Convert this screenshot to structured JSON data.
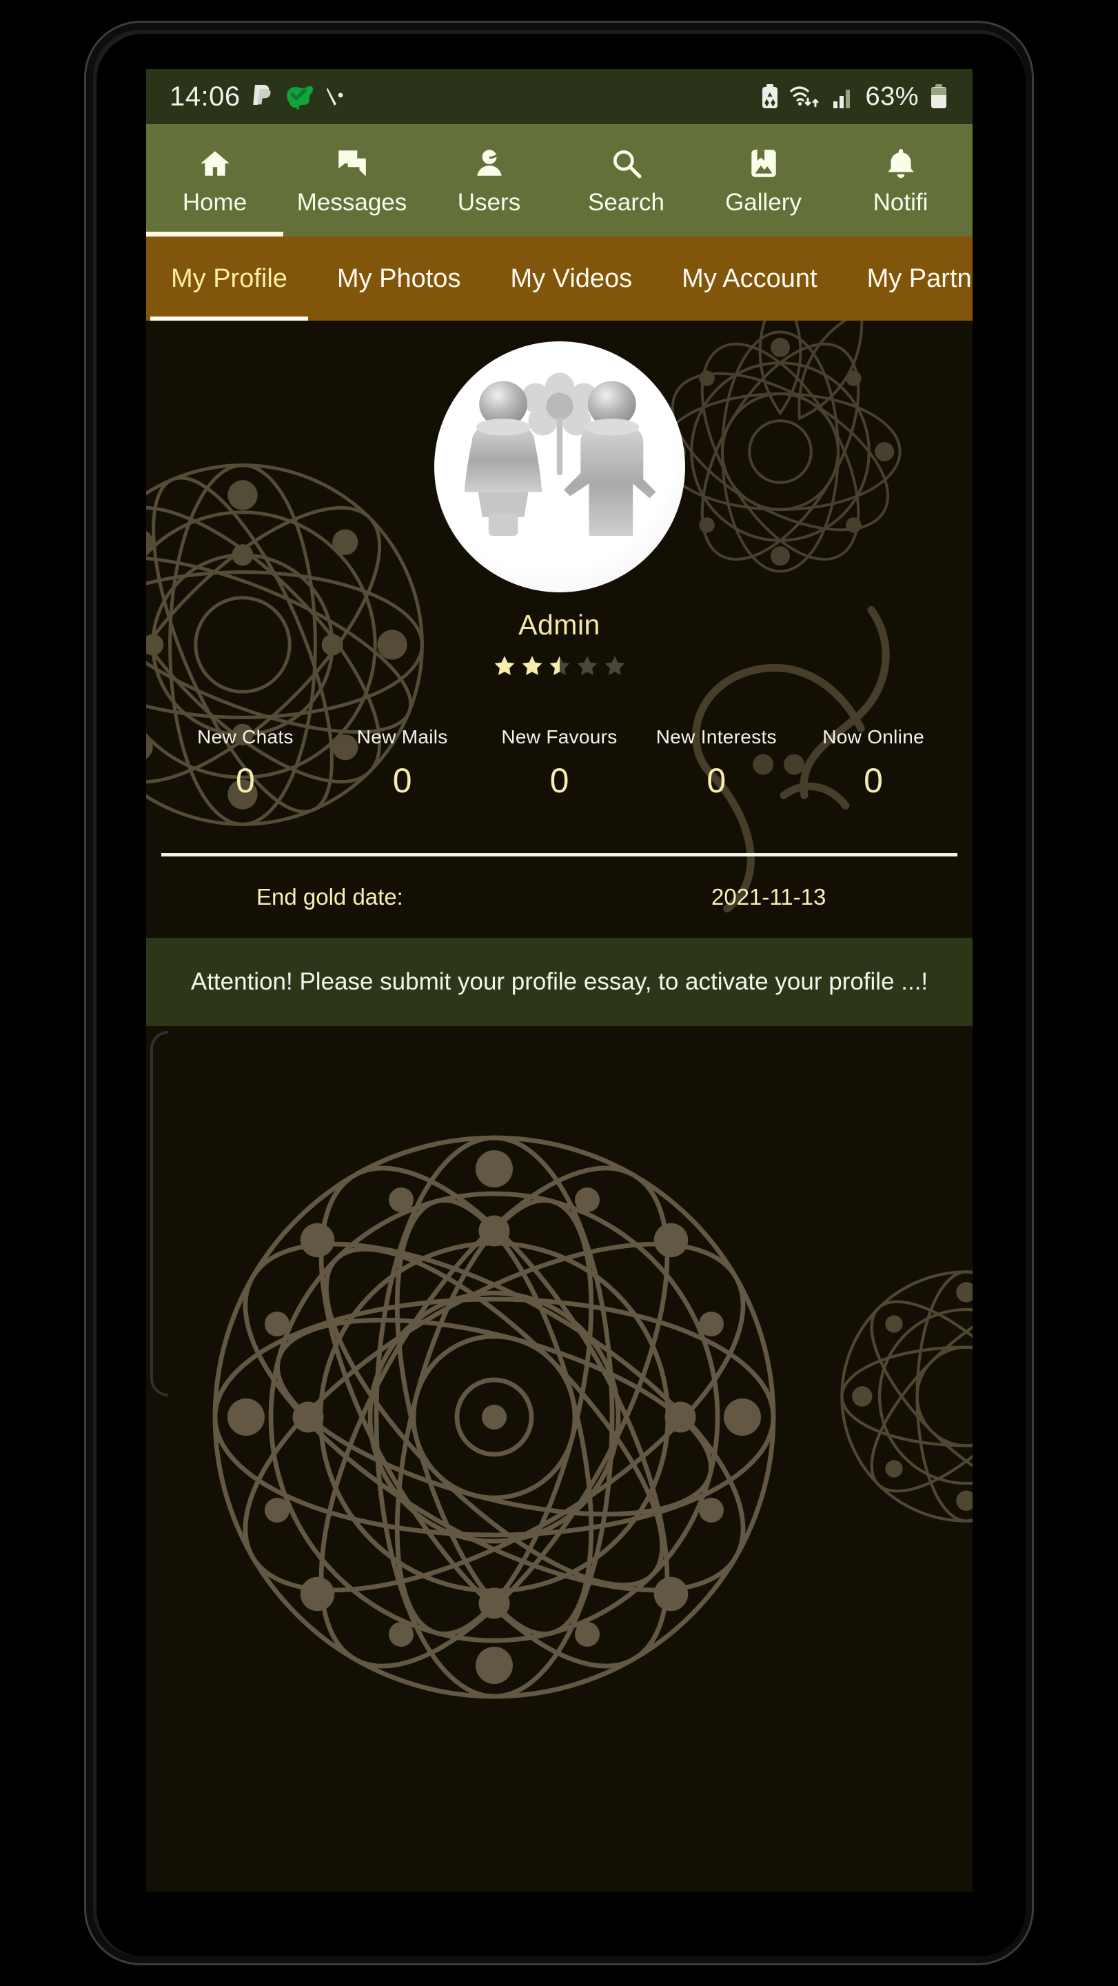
{
  "status_bar": {
    "clock": "14:06",
    "left_icons": [
      "paypal-icon",
      "australia-check-icon",
      "stylus-icon"
    ],
    "right_icons": [
      "battery-saver-icon",
      "wifi-icon",
      "signal-bars-icon"
    ],
    "battery_percent": "63%",
    "background_color": "#2a3418"
  },
  "top_nav": {
    "background_color": "#63703a",
    "items": [
      {
        "label": "Home",
        "icon": "home-icon",
        "active": true
      },
      {
        "label": "Messages",
        "icon": "chat-icon",
        "active": false
      },
      {
        "label": "Users",
        "icon": "person-icon",
        "active": false
      },
      {
        "label": "Search",
        "icon": "search-icon",
        "active": false
      },
      {
        "label": "Gallery",
        "icon": "gallery-icon",
        "active": false
      },
      {
        "label": "Notifi",
        "icon": "bell-icon",
        "active": false
      }
    ]
  },
  "tab_bar": {
    "background_color": "#81560c",
    "active_color": "#fbefa8",
    "items": [
      {
        "label": "My Profile",
        "active": true
      },
      {
        "label": "My Photos",
        "active": false
      },
      {
        "label": "My Videos",
        "active": false
      },
      {
        "label": "My Account",
        "active": false
      },
      {
        "label": "My Partner",
        "active": false
      }
    ]
  },
  "profile": {
    "avatar_icon": "couple-with-flower-avatar",
    "display_name": "Admin",
    "rating_value": 2.5,
    "rating_max": 5,
    "star_filled_color": "#f7edad",
    "star_empty_color": "#4a463c"
  },
  "stats": [
    {
      "label": "New Chats",
      "value": "0"
    },
    {
      "label": "New Mails",
      "value": "0"
    },
    {
      "label": "New Favours",
      "value": "0"
    },
    {
      "label": "New Interests",
      "value": "0"
    },
    {
      "label": "Now Online",
      "value": "0"
    }
  ],
  "gold": {
    "label": "End gold date:",
    "value": "2021-11-13"
  },
  "attention": {
    "message": "Attention! Please submit your profile essay, to activate your profile ...!",
    "background_color": "#2c3618"
  },
  "android_nav": {
    "buttons": [
      {
        "name": "recent-apps-icon"
      },
      {
        "name": "home-circle-icon"
      },
      {
        "name": "back-icon"
      }
    ],
    "background_color": "#f1f1f0"
  }
}
